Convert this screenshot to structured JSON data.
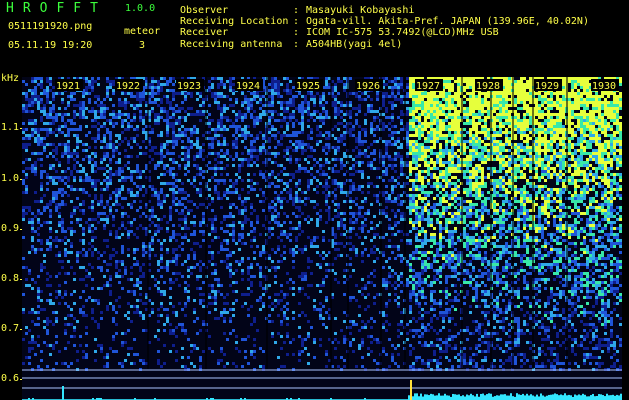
{
  "app": {
    "name": "HROFFT",
    "version": "1.0.0"
  },
  "file": {
    "name": "0511191920.png",
    "datetime": "05.11.19 19:20"
  },
  "meteor": {
    "label": "meteor",
    "count": "3"
  },
  "info": [
    {
      "key": "Observer",
      "value": "Masayuki Kobayashi"
    },
    {
      "key": "Receiving Location",
      "value": "Ogata-vill. Akita-Pref. JAPAN (139.96E, 40.02N)"
    },
    {
      "key": "Receiver",
      "value": "ICOM IC-575 53.7492(@LCD)MHz USB"
    },
    {
      "key": "Receiving antenna",
      "value": "A504HB(yagi 4el)"
    }
  ],
  "axis": {
    "unit": "kHz",
    "y_ticks": [
      "1.1",
      "1.0",
      "0.9",
      "0.8",
      "0.7",
      "0.6"
    ],
    "minute_labels": [
      "1921",
      "1922",
      "1923",
      "1924",
      "1925",
      "1926",
      "1927",
      "1928",
      "1929",
      "1930"
    ]
  },
  "colors": {
    "label": "#ffff4a",
    "brand": "#3cff3c",
    "trace": "#33e6ff",
    "background": "#000000"
  }
}
